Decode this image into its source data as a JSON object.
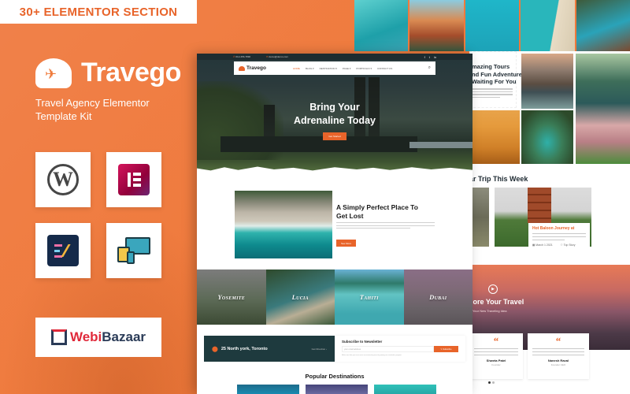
{
  "promo": {
    "badge": "30+ ELEMENTOR SECTION",
    "brand_name": "Travego",
    "tagline": "Travel Agency Elementor Template Kit",
    "compat_icons": [
      "wordpress-icon",
      "elementor-icon",
      "envato-elements-icon",
      "responsive-devices-icon"
    ],
    "vendor": {
      "part1": "Webi",
      "part2": "Bazaar"
    },
    "accent_color": "#ef7b3c"
  },
  "mock_site": {
    "topbar": {
      "phone": "012-456-7890",
      "email": "demo@demo.com",
      "social": [
        "f",
        "t",
        "in"
      ]
    },
    "nav": {
      "logo": "Travego",
      "items": [
        "HOME",
        "BLOG ▾",
        "DESTINATION ▾",
        "PAGE ▾",
        "PORTFOLIO ▾",
        "CONTACT US"
      ],
      "search_icon": "⌕"
    },
    "hero": {
      "title_line1": "Bring Your",
      "title_line2": "Adrenaline Today",
      "cta": "Get Started"
    },
    "about": {
      "title": "A Simply Perfect Place To Get Lost",
      "button": "See More"
    },
    "destinations": [
      "Yosemite",
      "Lucia",
      "Tahiti",
      "Dubai"
    ],
    "location": {
      "address": "25 North york, Toronto",
      "directions": "Get Direction ›"
    },
    "newsletter": {
      "title": "Subscribe to Newsletter",
      "placeholder": "your email address",
      "button": "✎ Subscribe",
      "note": "Make sure that you never miss our interesting news by joining our newsletter program"
    },
    "popular": {
      "title": "Popular Destinations"
    }
  },
  "right_page": {
    "tours_heading": "mazing Tours\nnd Fun Adventures\nWaiting For You",
    "trip_heading": "ar Trip This Week",
    "trip_card": {
      "title": "Hot Baloon Journey at",
      "date": "▦ March 1 2021",
      "tag": "⚐ Top Story"
    },
    "explore": {
      "title": "lore Your Travel",
      "subtitle": "Your New Traveling Idea",
      "play": "▶"
    },
    "testimonials": [
      {
        "quote": "“",
        "name": "Shweta Patel",
        "role": "Founder"
      },
      {
        "quote": "“",
        "name": "Nanesh Raval",
        "role": "Founder CEO"
      }
    ]
  }
}
